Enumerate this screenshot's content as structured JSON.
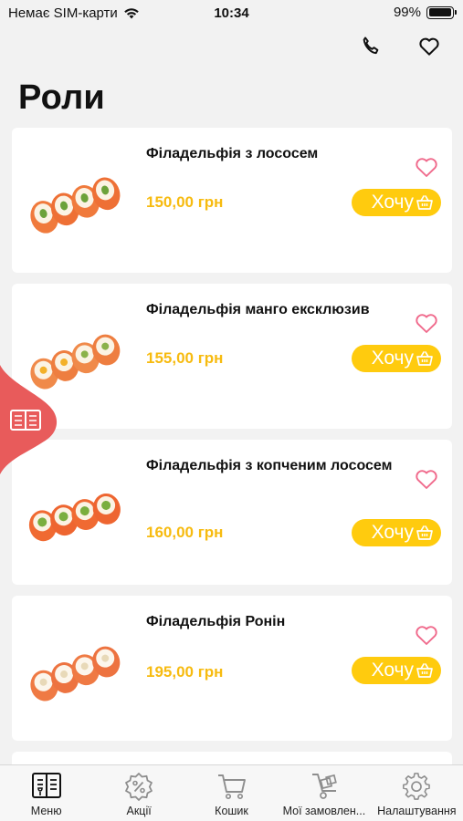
{
  "status": {
    "carrier": "Немає SIM-карти",
    "time": "10:34",
    "battery": "99%",
    "battery_level": 0.99
  },
  "header": {
    "title": "Роли",
    "actions": [
      {
        "icon": "phone-icon"
      },
      {
        "icon": "heart-icon"
      }
    ]
  },
  "products": [
    {
      "name": "Філадельфія з лососем",
      "price": "150,00 грн",
      "button": "Хочу"
    },
    {
      "name": "Філадельфія манго ексклюзив",
      "price": "155,00 грн",
      "button": "Хочу"
    },
    {
      "name": "Філадельфія з копченим лососем",
      "price": "160,00 грн",
      "button": "Хочу"
    },
    {
      "name": "Філадельфія Ронін",
      "price": "195,00 грн",
      "button": "Хочу"
    }
  ],
  "tabs": [
    {
      "label": "Меню",
      "icon": "menu-book-icon",
      "active": true
    },
    {
      "label": "Акції",
      "icon": "discount-icon",
      "active": false
    },
    {
      "label": "Кошик",
      "icon": "cart-icon",
      "active": false
    },
    {
      "label": "Мої замовлен...",
      "icon": "orders-icon",
      "active": false
    },
    {
      "label": "Налаштування",
      "icon": "gear-icon",
      "active": false
    }
  ],
  "colors": {
    "accent": "#ffcb0e",
    "price": "#f7bb10",
    "favorite": "#f06a8c",
    "side_tab": "#e85b5b",
    "background": "#f2f2f2"
  }
}
